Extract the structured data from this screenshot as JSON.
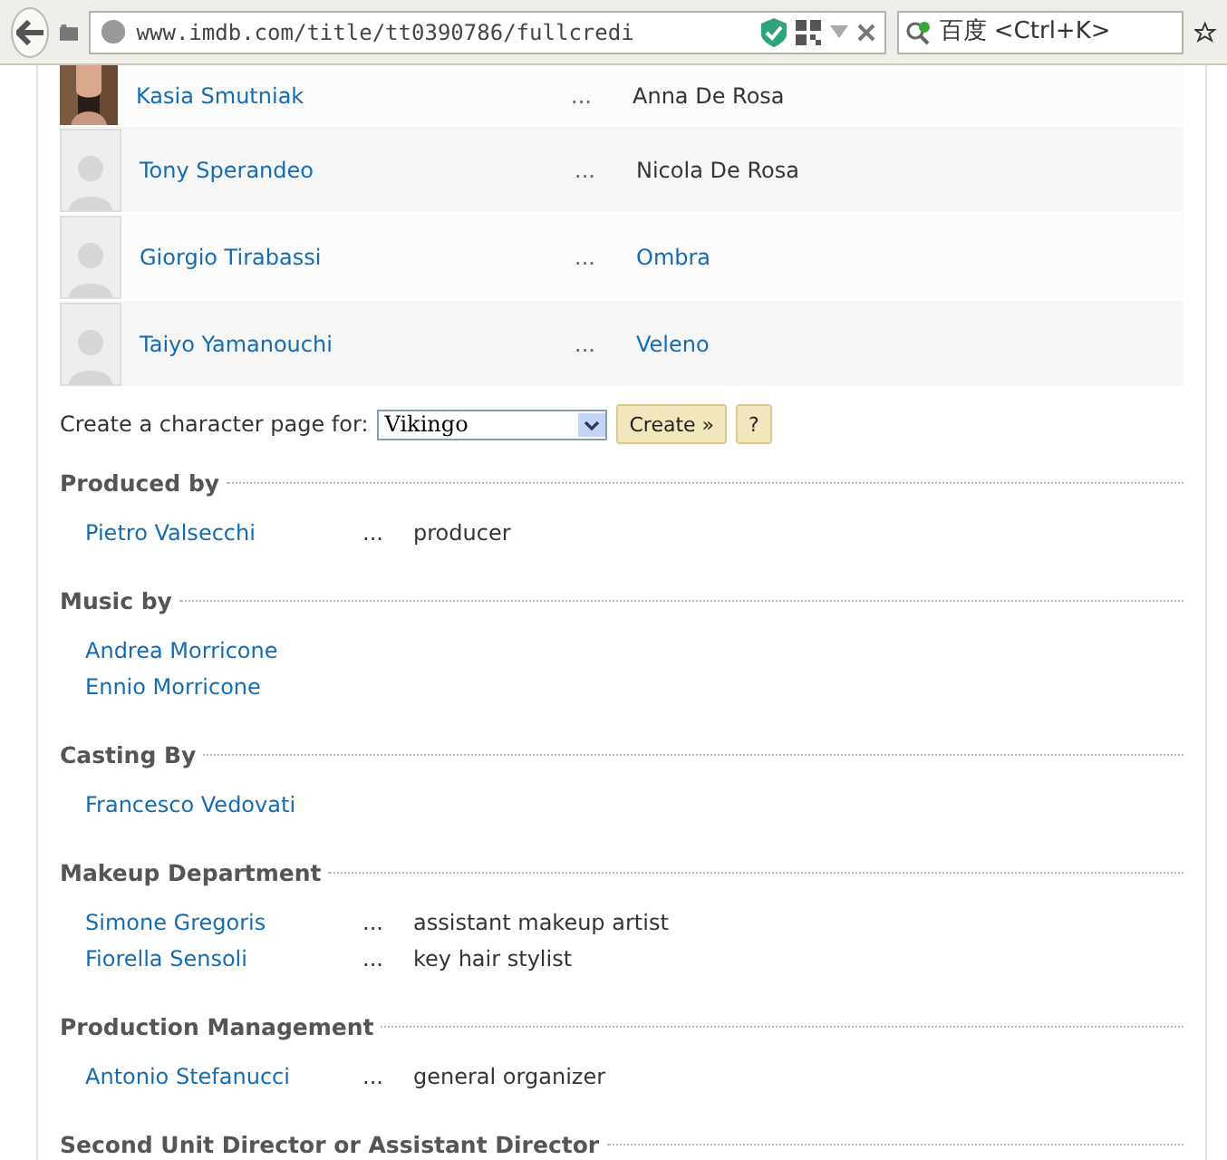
{
  "browser": {
    "url": "www.imdb.com/title/tt0390786/fullcredi",
    "search_placeholder": "百度 <Ctrl+K>"
  },
  "cast": [
    {
      "name": "Kasia Smutniak",
      "dots": "...",
      "character": "Anna De Rosa",
      "photo": true,
      "character_link": false
    },
    {
      "name": "Tony Sperandeo",
      "dots": "...",
      "character": "Nicola De Rosa",
      "photo": false,
      "character_link": false
    },
    {
      "name": "Giorgio Tirabassi",
      "dots": "...",
      "character": "Ombra",
      "photo": false,
      "character_link": true
    },
    {
      "name": "Taiyo Yamanouchi",
      "dots": "...",
      "character": "Veleno",
      "photo": false,
      "character_link": true
    }
  ],
  "character_page": {
    "label": "Create a character page for:",
    "value": "Vikingo",
    "create_button": "Create »",
    "help_button": "?"
  },
  "sections": [
    {
      "title": "Produced by",
      "people": [
        {
          "name": "Pietro Valsecchi",
          "dots": "...",
          "role": "producer"
        }
      ]
    },
    {
      "title": "Music by",
      "people": [
        {
          "name": "Andrea Morricone"
        },
        {
          "name": "Ennio Morricone"
        }
      ]
    },
    {
      "title": "Casting By",
      "people": [
        {
          "name": "Francesco Vedovati"
        }
      ]
    },
    {
      "title": "Makeup Department",
      "people": [
        {
          "name": "Simone Gregoris",
          "dots": "...",
          "role": "assistant makeup artist"
        },
        {
          "name": "Fiorella Sensoli",
          "dots": "...",
          "role": "key hair stylist"
        }
      ]
    },
    {
      "title": "Production Management",
      "people": [
        {
          "name": "Antonio Stefanucci",
          "dots": "...",
          "role": "general organizer"
        }
      ]
    },
    {
      "title": "Second Unit Director or Assistant Director"
    }
  ]
}
